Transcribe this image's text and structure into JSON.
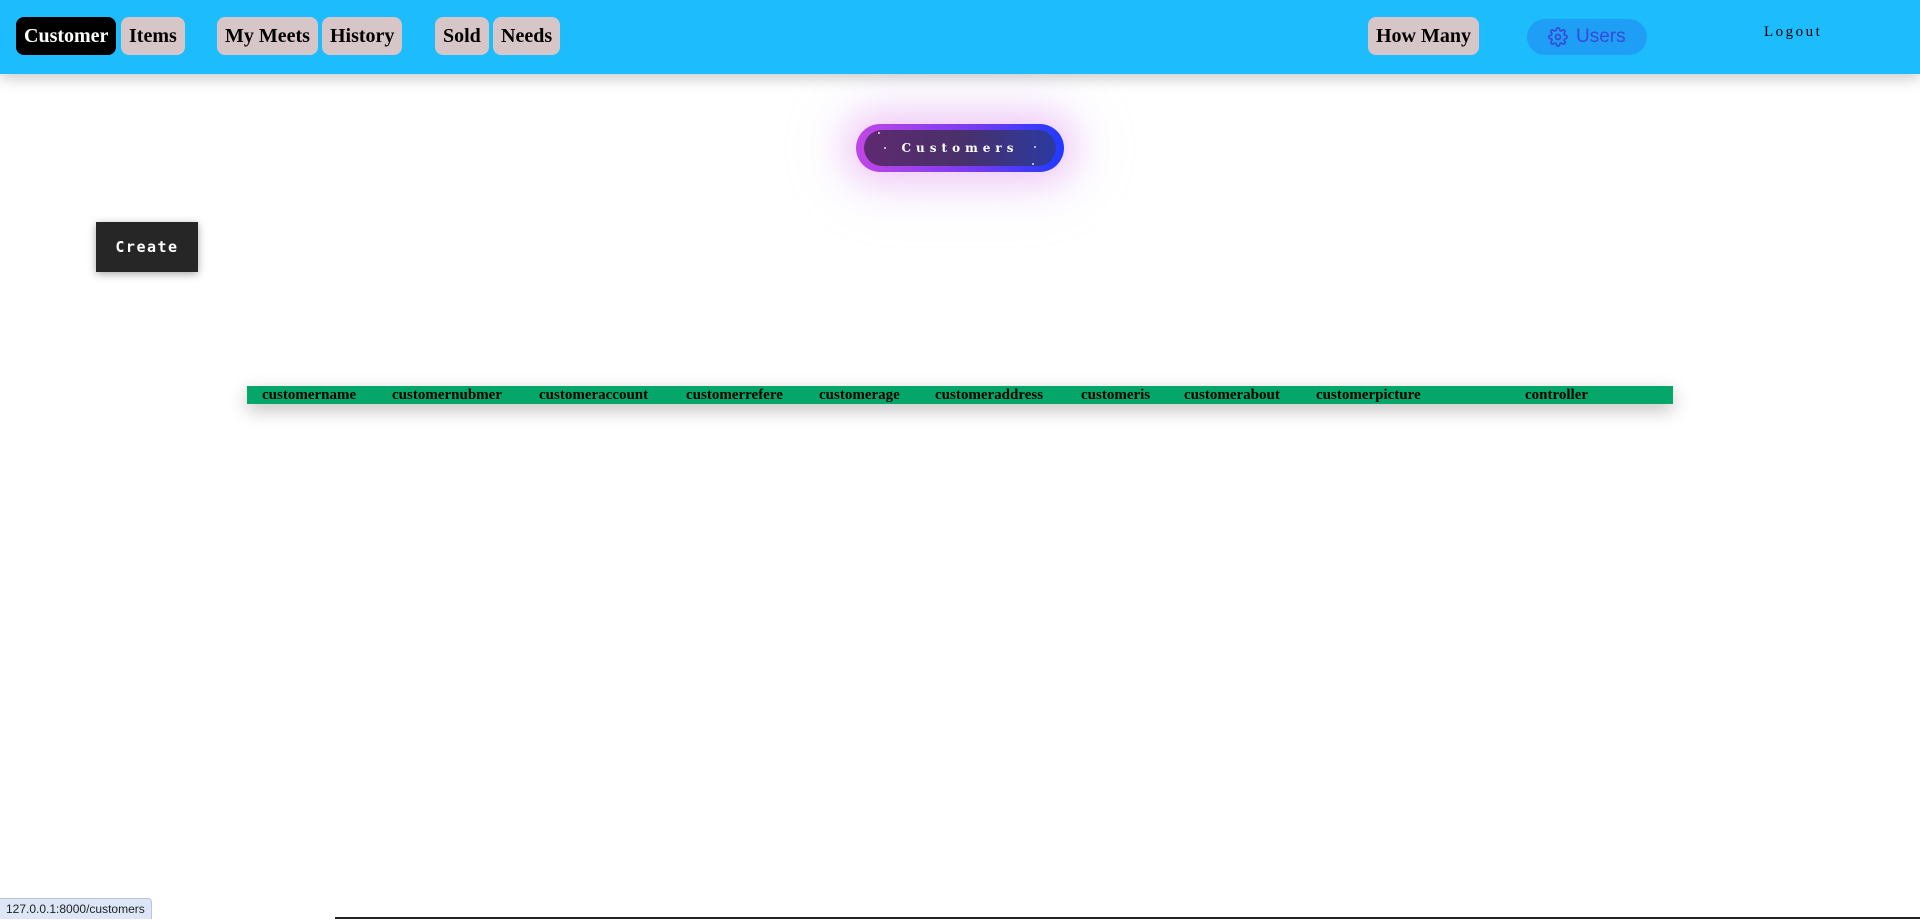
{
  "navbar": {
    "buttons": [
      {
        "label": "Customer",
        "active": true
      },
      {
        "label": "Items",
        "active": false
      },
      {
        "label": "My Meets",
        "active": false
      },
      {
        "label": "History",
        "active": false
      },
      {
        "label": "Sold",
        "active": false
      },
      {
        "label": "Needs",
        "active": false
      },
      {
        "label": "How Many",
        "active": false
      }
    ],
    "users_label": "Users",
    "users_icon": "gear-icon",
    "logout_label": "Logout"
  },
  "page": {
    "title": "Customers",
    "create_label": "Create"
  },
  "table": {
    "headers": [
      "customername",
      "customernubmer",
      "customeraccount",
      "customerrefere",
      "customerage",
      "customeraddress",
      "customeris",
      "customerabout",
      "customerpicture",
      "controller"
    ],
    "rows": []
  },
  "status_bar": {
    "url": "127.0.0.1:8000/customers"
  },
  "colors": {
    "navbar_bg": "#1dbdfd",
    "nav_button_bg": "#d7c6c8",
    "nav_active_bg": "#000000",
    "table_header_bg": "#04a769",
    "create_bg": "#262626"
  }
}
